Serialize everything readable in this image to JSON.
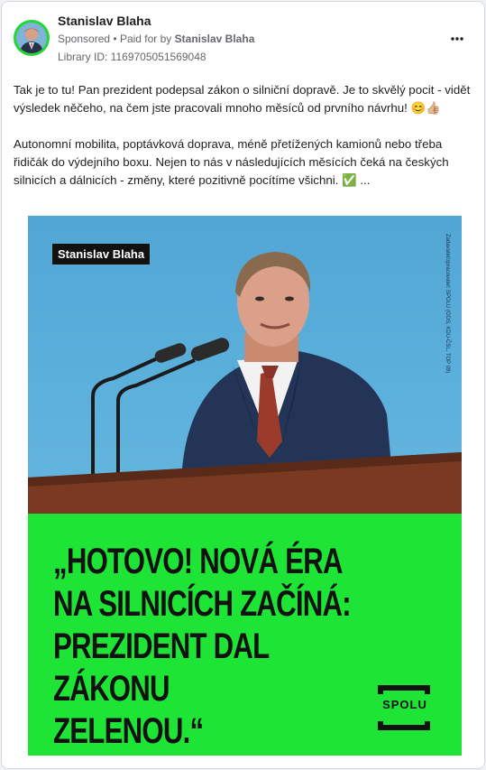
{
  "post": {
    "advertiser_name": "Stanislav Blaha",
    "sponsored_label": "Sponsored",
    "paid_for_prefix": "Paid for by",
    "paid_for_by": "Stanislav Blaha",
    "library_id": "Library ID: 1169705051569048",
    "more_icon": "more-options-icon",
    "paragraph_1": "Tak je to tu! Pan prezident podepsal zákon o silniční dopravě. Je to skvělý pocit - vidět výsledek něčeho, na čem jste pracovali mnoho měsíců od prvního návrhu! 😊👍🏼",
    "paragraph_2": "Autonomní mobilita, poptávková doprava, méně přetížených kamionů nebo třeba řidičák do výdejního boxu. Nejen to nás v následujících měsících čeká na českých silnicích a dálnicích - změny, které pozitivně pocítíme všichni. ✅",
    "see_more": "..."
  },
  "creative": {
    "name_tag": "Stanislav Blaha",
    "credit": "Zadavatel/zpracovatel: SPOLU (ODS, KDU-ČSL, TOP 09)",
    "headline_lines": [
      "„HOTOVO! NOVÁ ÉRA",
      "NA SILNICÍCH ZAČÍNÁ:",
      "PREZIDENT DAL ZÁKONU",
      "ZELENOU.“"
    ],
    "logo_text": "SPOLU",
    "panel_color": "#1ee436",
    "sky_color": "#5cb0dc"
  }
}
